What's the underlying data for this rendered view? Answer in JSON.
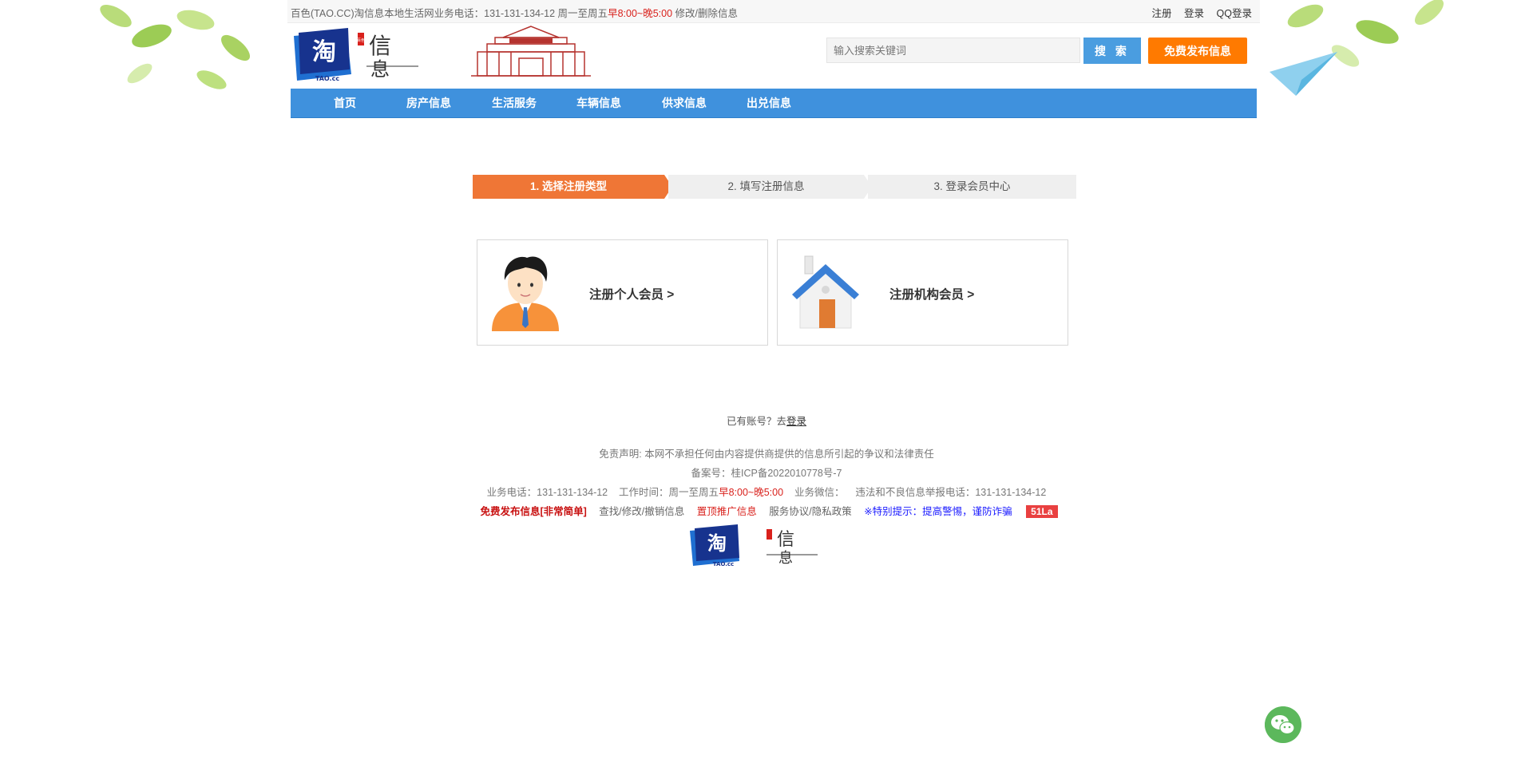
{
  "topbar": {
    "notice_prefix": "百色(TAO.CC)淘信息本地生活网业务电话：131-131-134-12 周一至周五",
    "notice_hours": "早8:00~晚5:00",
    "notice_link": "修改/删除信息",
    "links": [
      "注册",
      "登录",
      "QQ登录"
    ]
  },
  "search": {
    "placeholder": "输入搜索关键词",
    "button": "搜 索"
  },
  "publish_button": "免费发布信息",
  "nav": [
    "首页",
    "房产信息",
    "生活服务",
    "车辆信息",
    "供求信息",
    "出兑信息"
  ],
  "steps": [
    "1. 选择注册类型",
    "2. 填写注册信息",
    "3. 登录会员中心"
  ],
  "cards": {
    "personal": "注册个人会员 >",
    "org": "注册机构会员 >"
  },
  "already": {
    "text": "已有账号？去",
    "login": "登录"
  },
  "footer": {
    "disclaimer": "免责声明: 本网不承担任何由内容提供商提供的信息所引起的争议和法律责任",
    "icp": "备案号：桂ICP备2022010778号-7",
    "phone_label": "业务电话：131-131-134-12",
    "work_time_prefix": "工作时间：周一至周五",
    "work_time_hours": "早8:00~晚5:00",
    "wechat_label": "业务微信：",
    "report": "违法和不良信息举报电话：131-131-134-12",
    "links": {
      "publish": "免费发布信息[非常简单]",
      "find": "查找/修改/撤销信息",
      "top": "置顶推广信息",
      "policy": "服务协议/隐私政策",
      "tip": "※特别提示：提高警惕，谨防诈骗",
      "badge": "51La"
    }
  },
  "logo_text": {
    "tao": "淘",
    "cc": "TAO.cc",
    "xin": "信",
    "xi": "息",
    "seal": "百色"
  },
  "colors": {
    "nav_blue": "#3f91dd",
    "step_orange": "#ef7636",
    "publish_orange": "#ff7a00",
    "search_blue": "#4a9de0"
  }
}
